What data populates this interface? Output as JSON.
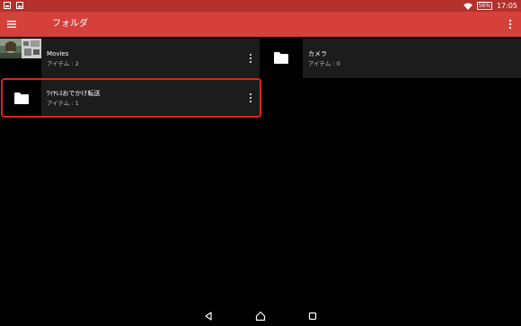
{
  "status_bar": {
    "icons_left": [
      "gallery-icon",
      "image-icon"
    ],
    "icons_right": [
      "wifi-icon",
      "battery-icon"
    ],
    "battery": "56%",
    "time": "17:05"
  },
  "app_bar": {
    "title": "フォルダ",
    "menu_icon": "hamburger-menu-icon",
    "overflow_icon": "more-vert-icon"
  },
  "folders": [
    {
      "name": "Movies",
      "count": "アイテム : 2",
      "thumb": "photo-thumbnails"
    },
    {
      "name": "カメラ",
      "count": "アイテム : 0",
      "thumb": "folder-icon"
    },
    {
      "name": "ﾜｲﾔﾚｽおでかけ転送",
      "count": "アイテム : 1",
      "thumb": "folder-icon",
      "highlighted": true
    }
  ],
  "nav_bar": {
    "buttons": [
      "back-icon",
      "home-icon",
      "recents-icon"
    ]
  },
  "colors": {
    "status_bar": "#b3312d",
    "app_bar": "#d5403a",
    "tile": "#1c1c1c",
    "highlight": "#e0221b",
    "background": "#000000"
  }
}
